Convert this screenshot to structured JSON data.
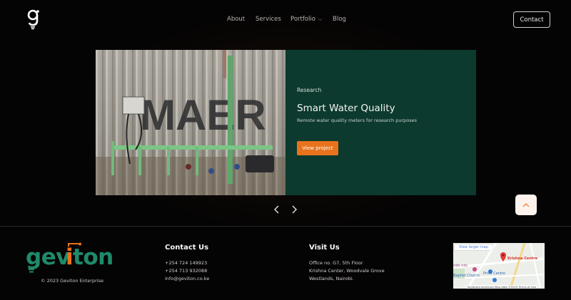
{
  "header": {
    "logo_icon": "geviton-g-bulb-icon",
    "nav": [
      {
        "label": "About"
      },
      {
        "label": "Services"
      },
      {
        "label": "Portfolio",
        "has_dropdown": true
      },
      {
        "label": "Blog"
      }
    ],
    "contact_label": "Contact"
  },
  "slide": {
    "category": "Research",
    "title": "Smart Water Quality",
    "description": "Remote water quality meters for research purposes",
    "button_label": "View project",
    "photo_text": "MAER",
    "panel_color": "#0c3a2e",
    "button_color": "#e8731c"
  },
  "carousel": {
    "prev_icon": "chevron-left-icon",
    "next_icon": "chevron-right-icon"
  },
  "scroll_top_icon": "chevron-up-icon",
  "footer": {
    "brand": "geviton",
    "copyright": "© 2023 Geviton Enterprise",
    "contact": {
      "heading": "Contact Us",
      "lines": [
        "+254 724 149923",
        "+254 713 932088",
        "info@geviton.co.ke"
      ]
    },
    "visit": {
      "heading": "Visit Us",
      "lines": [
        "Office no. G7, 5th Floor",
        "Krishna Center, Woodvale Grove",
        "Westlands, Nairobi."
      ]
    },
    "map": {
      "link": "View larger map",
      "pin_label": "Krishna Centre",
      "place1": "Pride Centre",
      "place2": "Baptist Church",
      "place3": "robi nds",
      "footer_text": "Keyboard shortcuts   Map data ©2023   Terms of Use"
    },
    "brand_colors": {
      "green": "#1f8a6a",
      "orange": "#e8731c"
    }
  }
}
